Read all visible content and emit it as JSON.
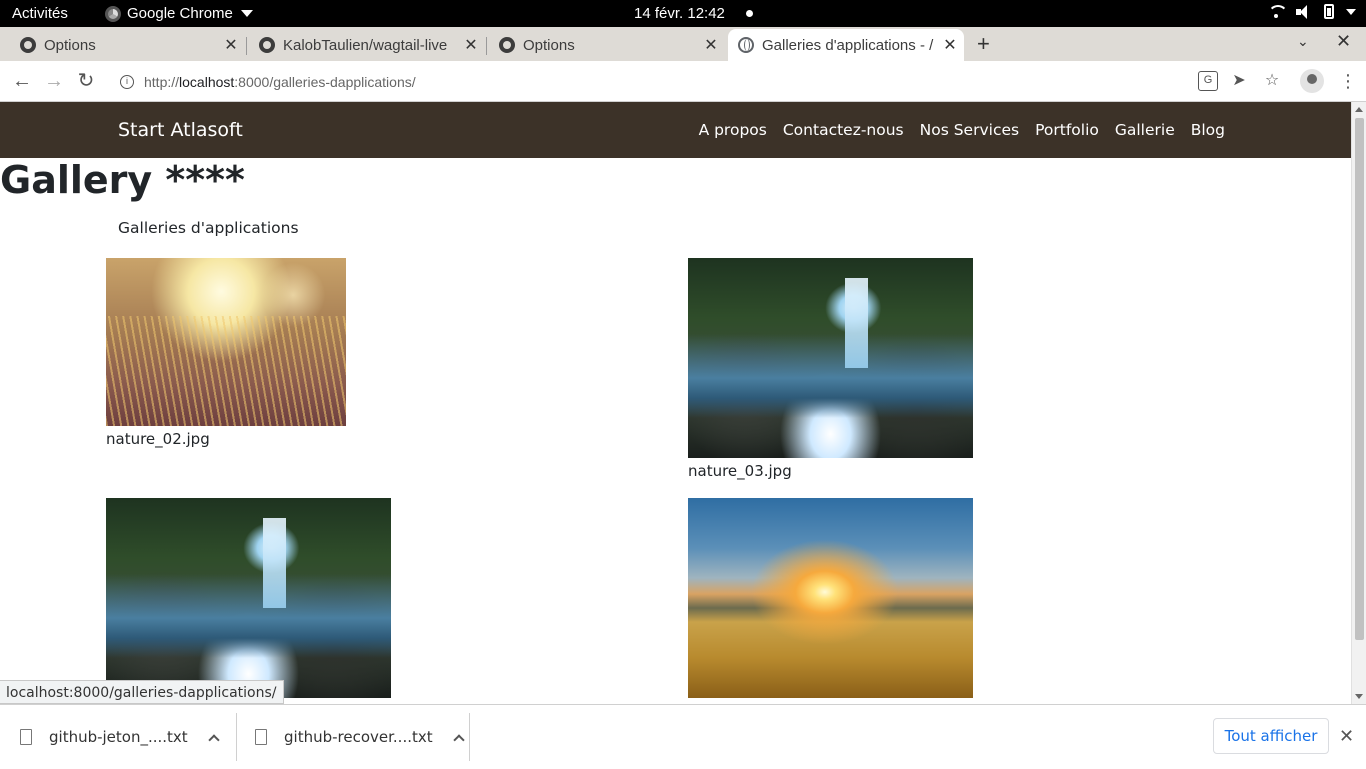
{
  "system_bar": {
    "activities": "Activités",
    "app_name": "Google Chrome",
    "clock": "14 févr.  12:42"
  },
  "tabs": [
    {
      "title": "Options",
      "icon": "github-icon",
      "active": false
    },
    {
      "title": "KalobTaulien/wagtail-live",
      "icon": "github-icon",
      "active": false
    },
    {
      "title": "Options",
      "icon": "github-icon",
      "active": false
    },
    {
      "title": "Galleries d'applications - /",
      "icon": "globe-icon",
      "active": true
    }
  ],
  "toolbar": {
    "url_scheme": "http://",
    "url_host": "localhost",
    "url_rest": ":8000/galleries-dapplications/"
  },
  "site": {
    "brand": "Start Atlasoft",
    "nav": [
      "A propos",
      "Contactez-nous",
      "Nos Services",
      "Portfolio",
      "Gallerie",
      "Blog"
    ],
    "page_title": "Gallery ****",
    "subtitle": "Galleries d'applications",
    "gallery": [
      {
        "caption": "nature_02.jpg",
        "image": "blurred golden grass at sunset"
      },
      {
        "caption": "nature_03.jpg",
        "image": "waterfall in forest"
      },
      {
        "caption": "",
        "image": "waterfall in forest"
      },
      {
        "caption": "",
        "image": "sunrise over wheat field"
      }
    ]
  },
  "status_url": "localhost:8000/galleries-dapplications/",
  "downloads": {
    "items": [
      "github-jeton_....txt",
      "github-recover....txt"
    ],
    "show_all": "Tout afficher"
  },
  "colors": {
    "site_nav_bg": "#3c3228",
    "link_blue": "#1a73e8"
  }
}
